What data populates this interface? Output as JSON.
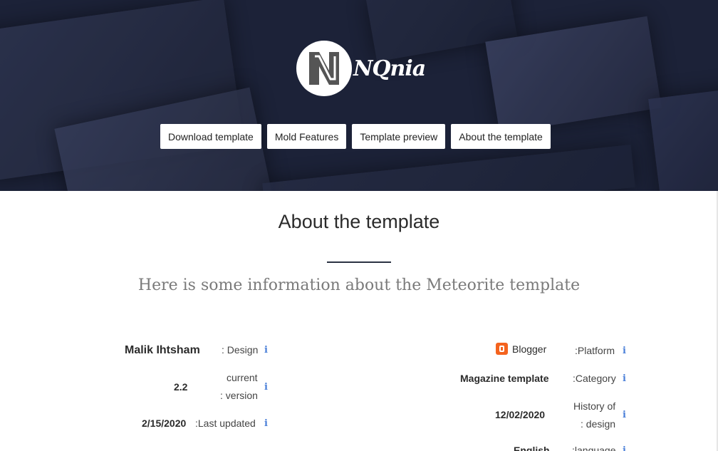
{
  "brand": {
    "name": "NQnia",
    "logo_letter": "N"
  },
  "nav": {
    "items": [
      {
        "label": "Download template"
      },
      {
        "label": "Mold Features"
      },
      {
        "label": "Template preview"
      },
      {
        "label": "About the template"
      }
    ]
  },
  "main": {
    "title": "About the template",
    "subtitle": "Here is some information about the Meteorite template"
  },
  "left_info": {
    "design": {
      "value": "Malik Ihtsham",
      "label": ": Design"
    },
    "version": {
      "value": "2.2",
      "label_line1": "current",
      "label_line2": ": version"
    },
    "updated": {
      "value": "2/15/2020",
      "label": ":Last updated"
    }
  },
  "right_info": {
    "platform": {
      "value": "Blogger",
      "label": ":Platform"
    },
    "category": {
      "value": "Magazine template",
      "label": ":Category"
    },
    "history": {
      "value": "12/02/2020",
      "label_line1": "History of",
      "label_line2": ": design"
    },
    "language": {
      "value": "English",
      "label": ":language"
    }
  },
  "icons": {
    "info": "i"
  },
  "colors": {
    "hero_bg": "#1c2238",
    "accent_info": "#4a7fd8",
    "blogger": "#f4631e"
  }
}
